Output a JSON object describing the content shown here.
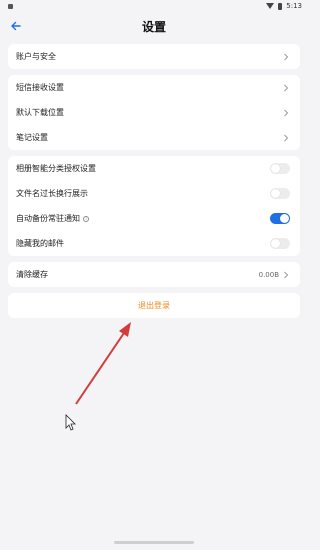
{
  "status_bar": {
    "time": "5:13"
  },
  "header": {
    "title": "设置"
  },
  "groups": [
    {
      "items": [
        {
          "label": "账户与安全"
        }
      ]
    },
    {
      "items": [
        {
          "label": "短信接收设置"
        },
        {
          "label": "默认下载位置"
        },
        {
          "label": "笔记设置"
        }
      ]
    },
    {
      "items": [
        {
          "label": "相册智能分类授权设置",
          "toggle": false
        },
        {
          "label": "文件名过长换行展示",
          "toggle": false
        },
        {
          "label": "自动备份常驻通知",
          "toggle": true,
          "info_icon": "info-icon"
        },
        {
          "label": "隐藏我的邮件",
          "toggle": false
        }
      ]
    },
    {
      "items": [
        {
          "label": "清除缓存",
          "value": "0.00B"
        }
      ]
    }
  ],
  "logout_label": "退出登录",
  "colors": {
    "accent": "#1f6fe5",
    "logout": "#f08a1c",
    "annotation_arrow": "#d33c3c"
  }
}
